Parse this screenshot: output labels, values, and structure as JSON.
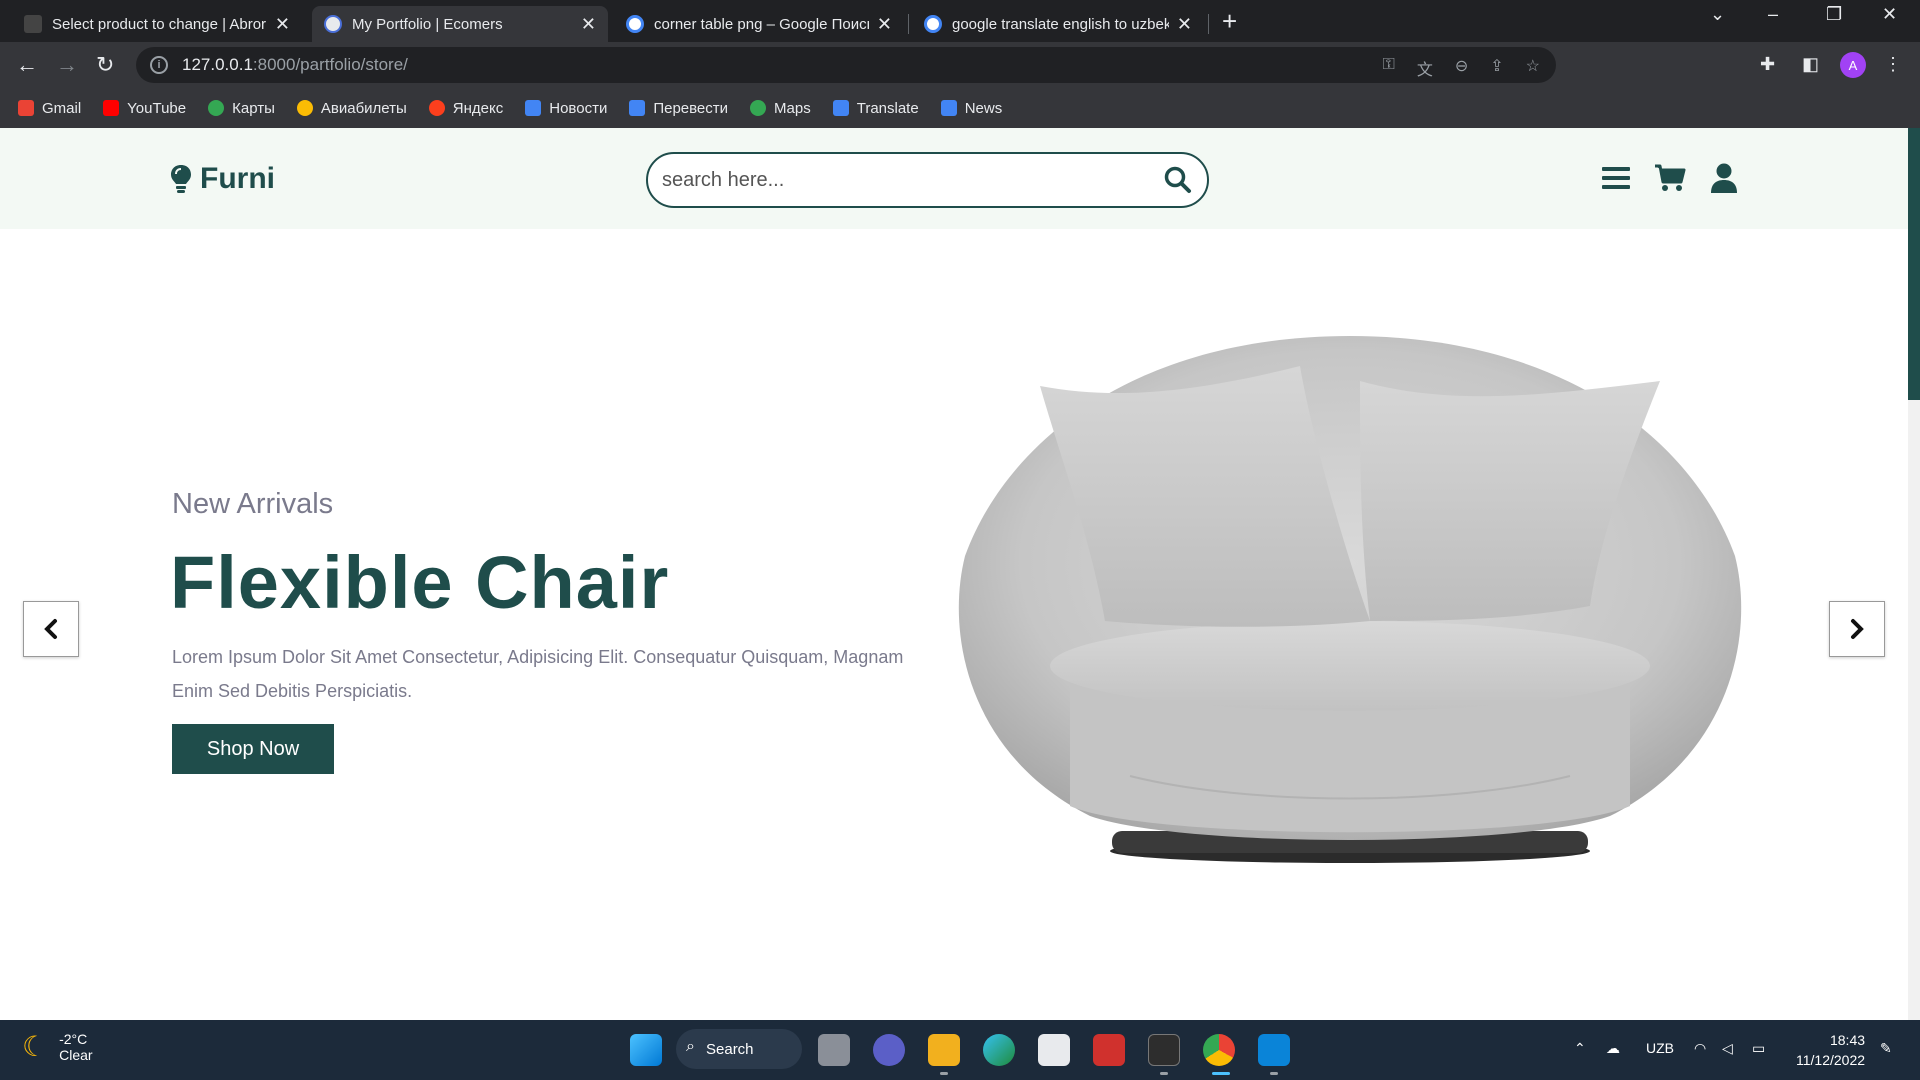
{
  "browser": {
    "tabs": [
      {
        "title": "Select product to change | Abror",
        "active": false
      },
      {
        "title": "My Portfolio | Ecomers",
        "active": true
      },
      {
        "title": "corner table png – Google Поиск",
        "active": false
      },
      {
        "title": "google translate english to uzbek",
        "active": false
      }
    ],
    "url_host": "127.0.0.1",
    "url_path": ":8000/partfolio/store/",
    "profile_initial": "A",
    "bookmarks": [
      "Gmail",
      "YouTube",
      "Карты",
      "Авиабилеты",
      "Яндекс",
      "Новости",
      "Перевести",
      "Maps",
      "Translate",
      "News"
    ]
  },
  "site": {
    "logo": "Furni",
    "search_placeholder": "search here...",
    "hero": {
      "subtitle": "New Arrivals",
      "title": "Flexible Chair",
      "description": "Lorem Ipsum Dolor Sit Amet Consectetur, Adipisicing Elit. Consequatur Quisquam, Magnam Enim Sed Debitis Perspiciatis.",
      "button": "Shop Now"
    },
    "colors": {
      "primary": "#1f4d4b",
      "header_bg": "#f3f9f4"
    }
  },
  "taskbar": {
    "temperature": "-2°C",
    "condition": "Clear",
    "search_label": "Search",
    "language": "UZB",
    "time": "18:43",
    "date": "11/12/2022"
  }
}
